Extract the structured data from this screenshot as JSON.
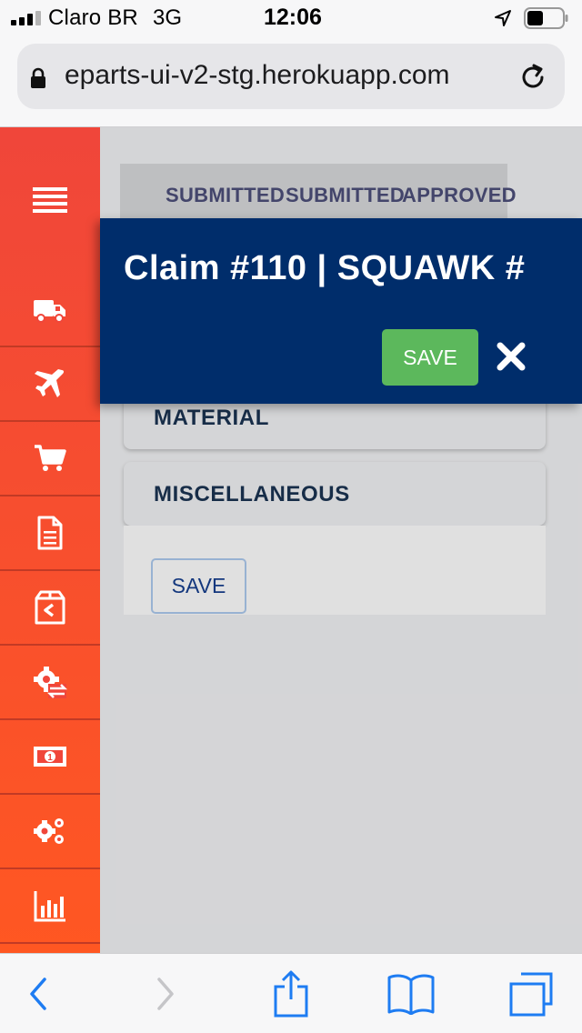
{
  "status_bar": {
    "carrier": "Claro BR",
    "network": "3G",
    "time": "12:06"
  },
  "browser": {
    "url": "eparts-ui-v2-stg.herokuapp.com"
  },
  "sidebar": {
    "items": [
      {
        "icon": "truck-icon"
      },
      {
        "icon": "airplane-icon"
      },
      {
        "icon": "cart-icon"
      },
      {
        "icon": "document-icon"
      },
      {
        "icon": "return-box-icon"
      },
      {
        "icon": "gear-exchange-icon"
      },
      {
        "icon": "money-icon"
      },
      {
        "icon": "gears-icon"
      },
      {
        "icon": "bar-chart-icon"
      }
    ]
  },
  "main": {
    "tabs": [
      "SUBMITTED",
      "SUBMITTED",
      "APPROVED"
    ],
    "sections": [
      {
        "label": "MATERIAL"
      },
      {
        "label": "MISCELLANEOUS"
      }
    ],
    "save_label": "SAVE"
  },
  "modal": {
    "title": "Claim #110 | SQUAWK #",
    "save_label": "SAVE"
  },
  "colors": {
    "sidebar": "#f0463a",
    "modal_header": "#002d6b",
    "save_green": "#5cb85c",
    "ios_blue": "#1e7cf2"
  }
}
